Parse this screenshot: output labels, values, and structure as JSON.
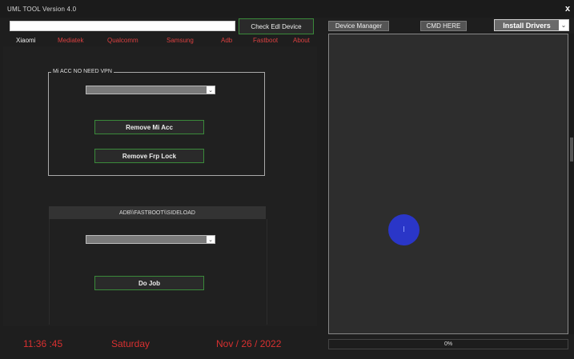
{
  "window": {
    "title": "UML TOOL Version 4.0",
    "close_label": "x"
  },
  "toolbar": {
    "path_value": "",
    "check_edl_label": "Check Edl Device",
    "device_manager_label": "Device Manager",
    "cmd_label": "CMD HERE",
    "install_drivers_label": "Install Drivers",
    "install_arrow": "⌄"
  },
  "tabs": [
    {
      "label": "Xiaomi",
      "active": true
    },
    {
      "label": "Mediatek",
      "active": false
    },
    {
      "label": "Qualcomm",
      "active": false
    },
    {
      "label": "Samsung",
      "active": false
    },
    {
      "label": "Adb",
      "active": false
    },
    {
      "label": "Fastboot",
      "active": false
    },
    {
      "label": "About",
      "active": false
    }
  ],
  "mi_group": {
    "legend": "Mi ACC NO NEED VPN",
    "combo_value": "",
    "combo_arrow": "⌄",
    "remove_mi_label": "Remove Mi Acc",
    "remove_frp_label": "Remove Frp Lock"
  },
  "adb_group": {
    "header": "ADB\\\\FASTBOOT\\\\SIDELOAD",
    "combo_value": "",
    "combo_arrow": "⌄",
    "do_job_label": "Do Job"
  },
  "clock": {
    "time": "11:36 :45",
    "day": "Saturday",
    "date": "Nov / 26 / 2022"
  },
  "progress": {
    "percent": 0,
    "label": "0%"
  },
  "console": {
    "cursor_glyph": "I"
  },
  "colors": {
    "accent_red": "#d93030",
    "button_border": "#3a8a3a",
    "cursor_blue": "#2a36c8"
  }
}
